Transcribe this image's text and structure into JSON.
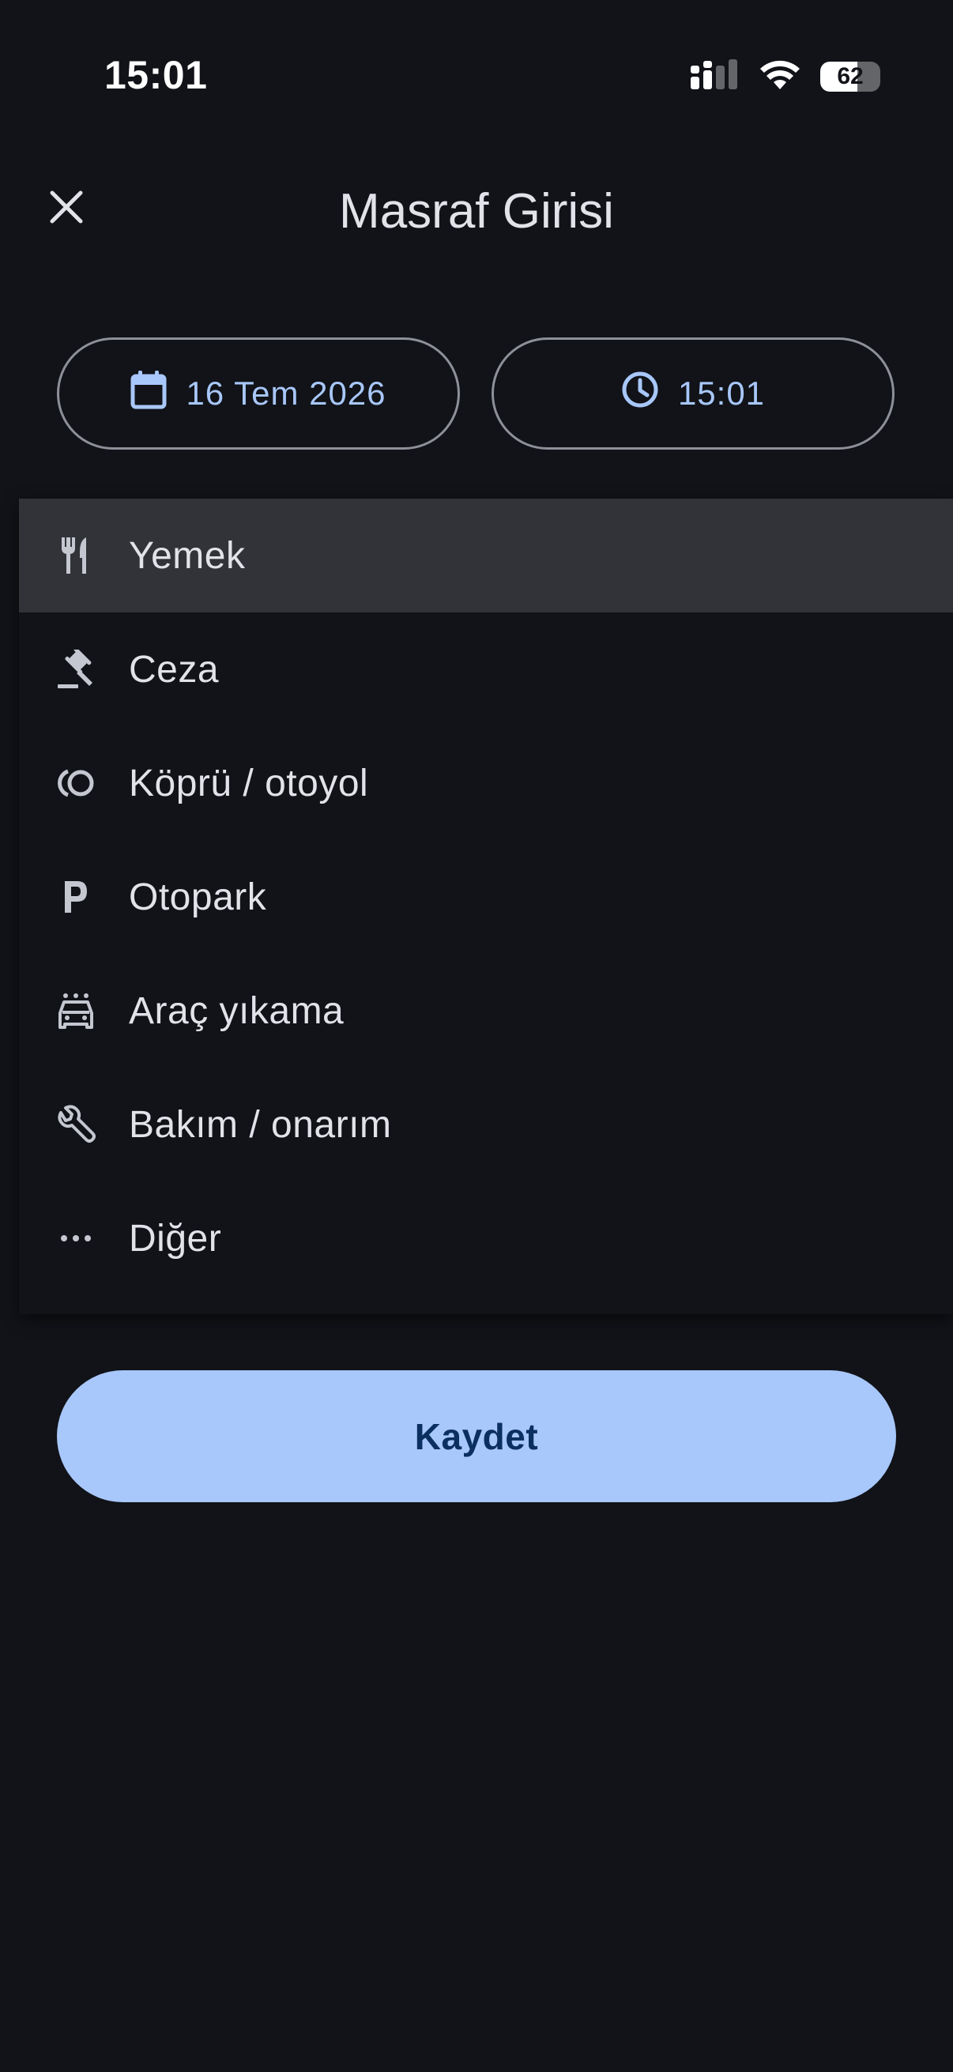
{
  "status_bar": {
    "time": "15:01",
    "battery_level": "62",
    "icons": [
      "signal-icon",
      "wifi-icon",
      "battery-icon"
    ]
  },
  "header": {
    "title": "Masraf Girisi",
    "close_icon": "close-icon"
  },
  "date_button": {
    "label": "16 Tem 2026",
    "icon": "calendar-icon"
  },
  "time_button": {
    "label": "15:01",
    "icon": "clock-icon"
  },
  "menu": {
    "items": [
      {
        "label": "Yemek",
        "icon": "restaurant-icon",
        "selected": true
      },
      {
        "label": "Ceza",
        "icon": "gavel-icon",
        "selected": false
      },
      {
        "label": "Köprü / otoyol",
        "icon": "toll-icon",
        "selected": false
      },
      {
        "label": "Otopark",
        "icon": "parking-icon",
        "selected": false
      },
      {
        "label": "Araç yıkama",
        "icon": "car-wash-icon",
        "selected": false
      },
      {
        "label": "Bakım / onarım",
        "icon": "wrench-icon",
        "selected": false
      },
      {
        "label": "Diğer",
        "icon": "more-horiz-icon",
        "selected": false
      }
    ]
  },
  "save_button": {
    "label": "Kaydet"
  },
  "colors": {
    "background": "#111318",
    "accent": "#a8c7fa",
    "on_accent": "#0b305f",
    "selected_item": "#323338",
    "outline": "#8e9099"
  }
}
